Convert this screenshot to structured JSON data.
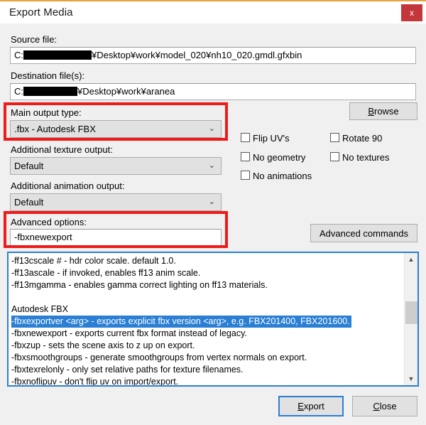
{
  "window": {
    "title": "Export Media",
    "close_label": "x",
    "accent_top": "#e8a33d",
    "close_bg": "#c3373b",
    "body_bg": "#f0f0f0"
  },
  "fields": {
    "source_label": "Source file:",
    "source_value_prefix": "C:",
    "source_value_suffix": "¥Desktop¥work¥model_020¥nh10_020.gmdl.gfxbin",
    "destination_label": "Destination file(s):",
    "destination_value_prefix": "C:",
    "destination_value_suffix": "¥Desktop¥work¥aranea"
  },
  "main_output": {
    "label": "Main output type:",
    "value": ".fbx - Autodesk FBX",
    "arrow": "⌄"
  },
  "texture_output": {
    "label": "Additional texture output:",
    "value": "Default",
    "arrow": "⌄"
  },
  "animation_output": {
    "label": "Additional animation output:",
    "value": "Default",
    "arrow": "⌄"
  },
  "advanced_options": {
    "label": "Advanced options:",
    "value": "-fbxnewexport"
  },
  "buttons": {
    "browse": {
      "mnemonic": "B",
      "rest": "rowse"
    },
    "advanced_commands": "Advanced commands",
    "export": {
      "mnemonic": "E",
      "rest": "xport"
    },
    "close": {
      "mnemonic": "C",
      "rest": "lose"
    }
  },
  "checkboxes": [
    {
      "label": "Flip UV's",
      "checked": false
    },
    {
      "label": "Rotate 90",
      "checked": false
    },
    {
      "label": "No geometry",
      "checked": false
    },
    {
      "label": "No textures",
      "checked": false
    },
    {
      "label": "No animations",
      "checked": false
    }
  ],
  "command_list": {
    "selected_index": 5,
    "rows": [
      "-ff13cscale # - hdr color scale. default 1.0.",
      "-ff13ascale - if invoked, enables ff13 anim scale.",
      "-ff13mgamma - enables gamma correct lighting on ff13 materials.",
      "",
      "Autodesk FBX",
      "-fbxexportver <arg> - exports explicit fbx version <arg>, e.g. FBX201400, FBX201600.",
      "-fbxnewexport - exports current fbx format instead of legacy.",
      "-fbxzup - sets the scene axis to z up on export.",
      "-fbxsmoothgroups - generate smoothgroups from vertex normals on export.",
      "-fbxtexrelonly - only set relative paths for texture filenames.",
      "-fbxnoflipuv - don't flip uv on import/export."
    ]
  },
  "scrollbar": {
    "up_glyph": "▲",
    "down_glyph": "▼"
  },
  "annotations": {
    "color": "#ee1b1b",
    "boxes": [
      "main-output-type",
      "advanced-options"
    ]
  }
}
